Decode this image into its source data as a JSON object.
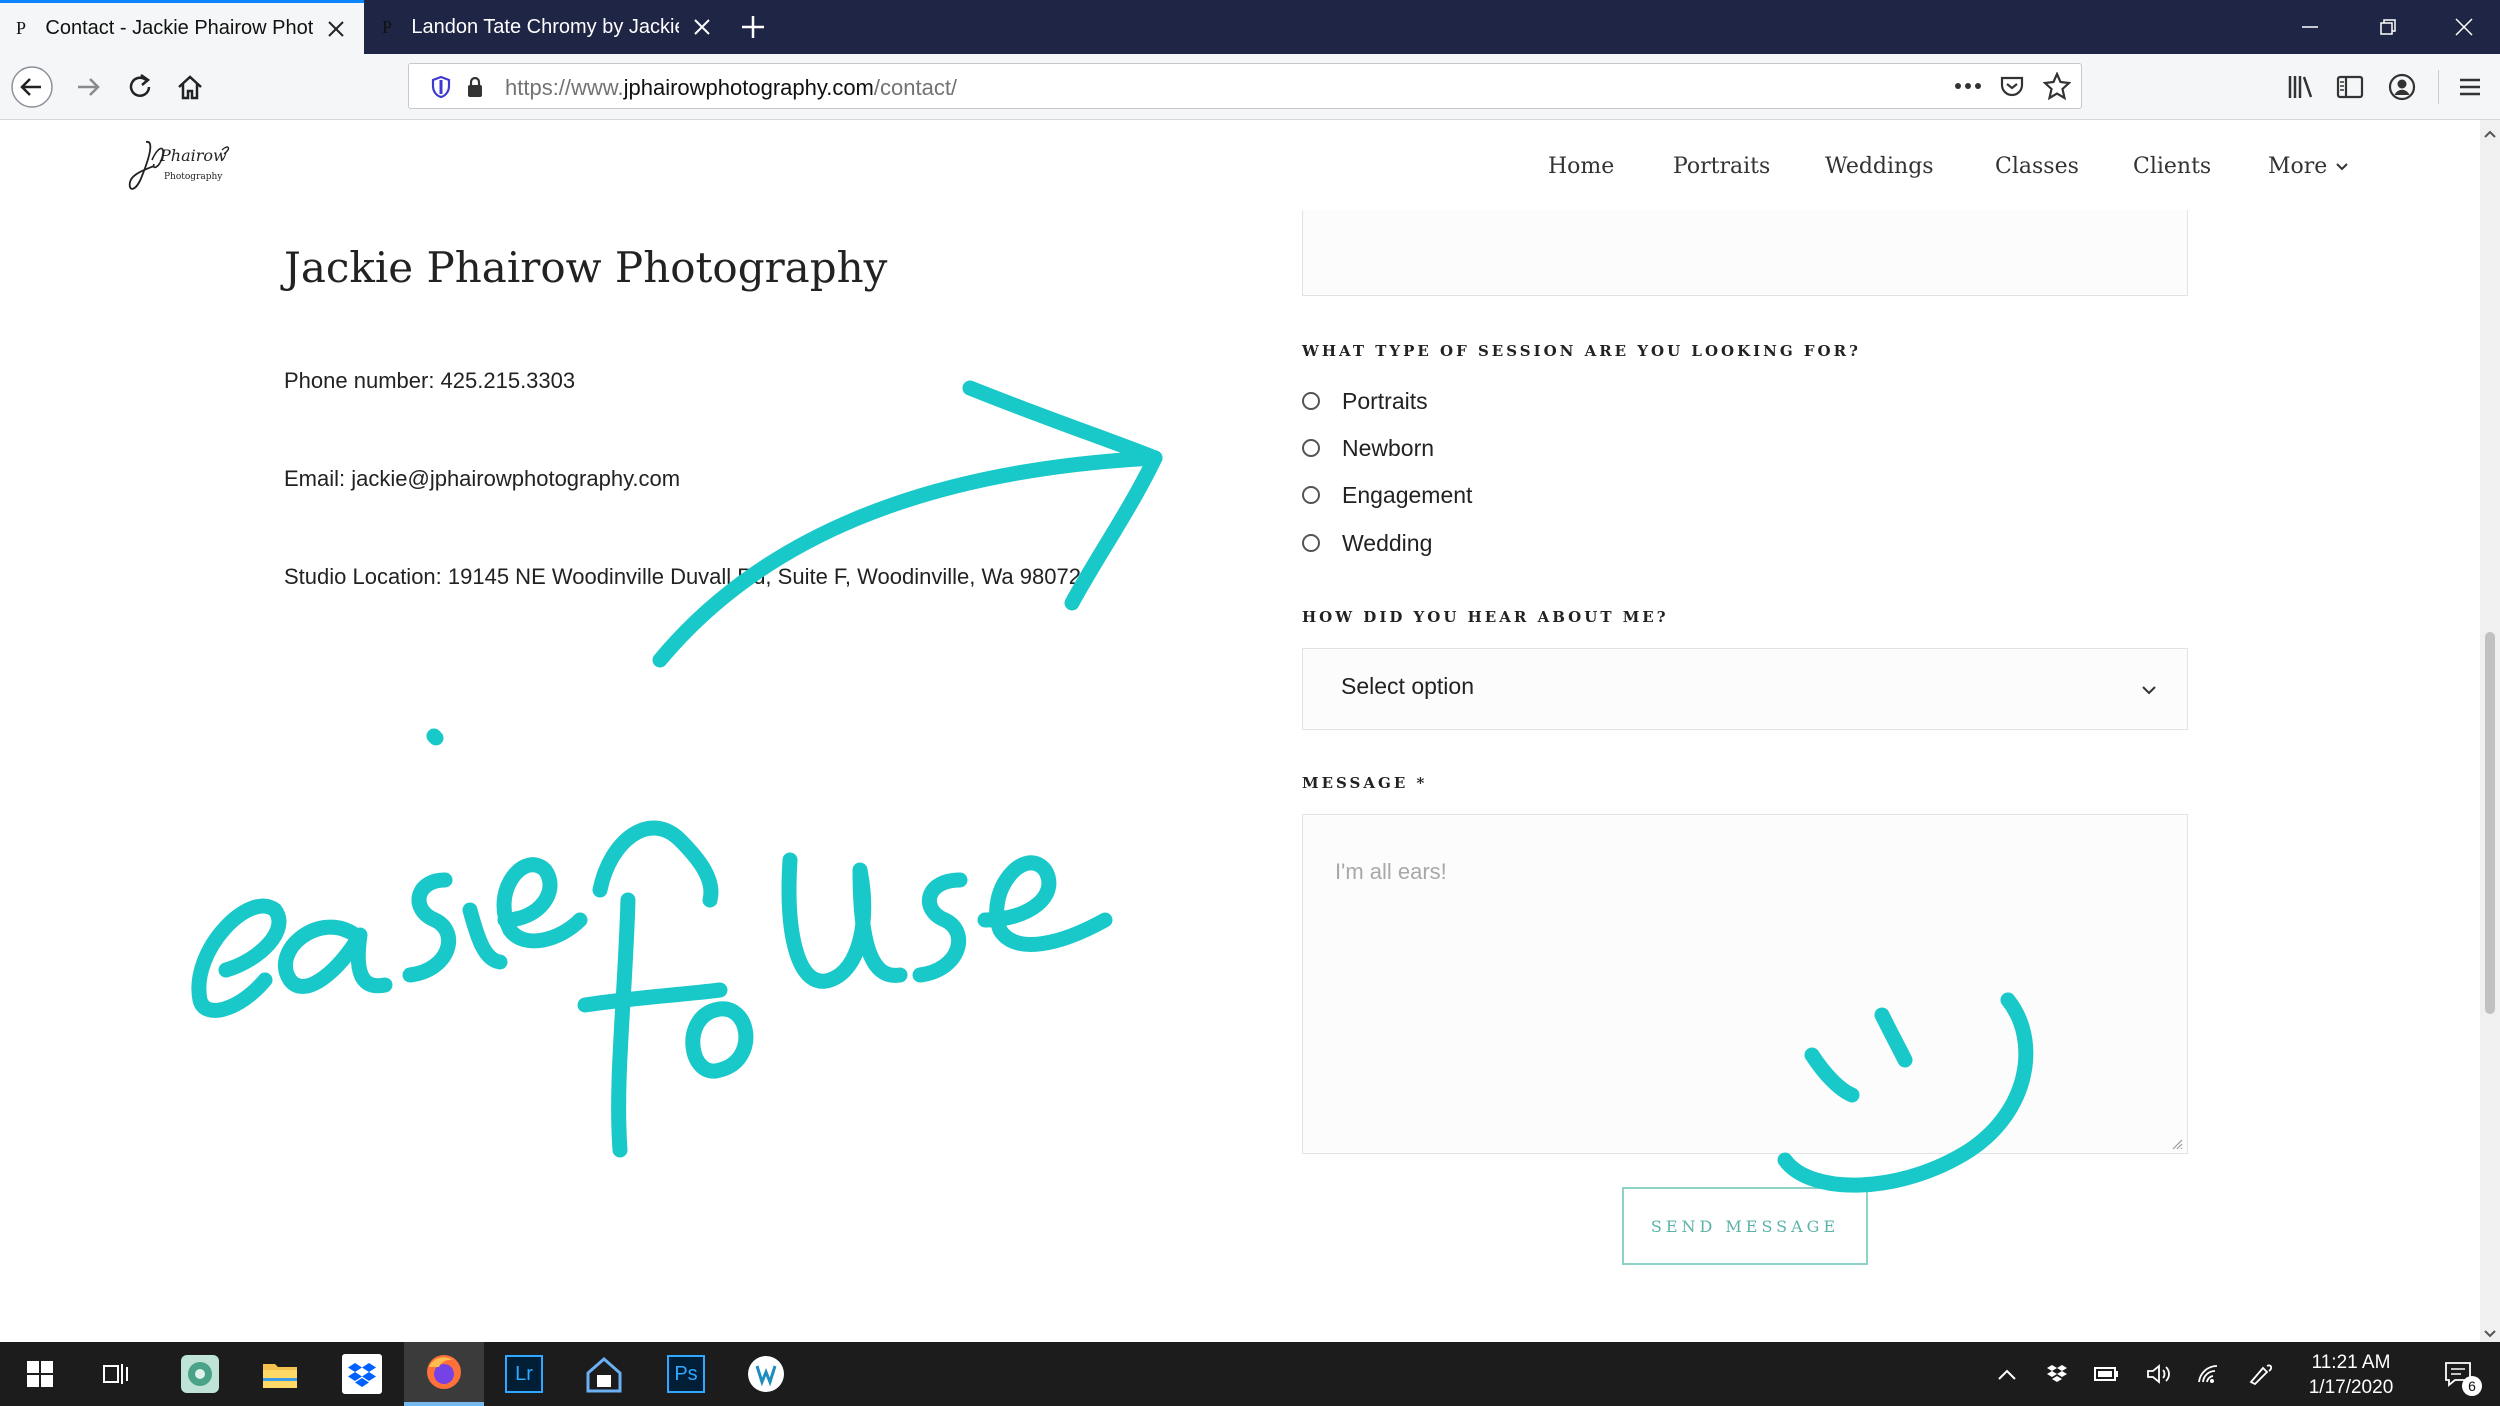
{
  "browser": {
    "tabs": [
      {
        "favicon": "P",
        "title": "Contact - Jackie Phairow Photo",
        "active": true
      },
      {
        "favicon": "P",
        "title": "Landon Tate Chromy by Jackie",
        "active": false
      }
    ],
    "url": {
      "prefix": "https://www.",
      "domain": "jphairowphotography.com",
      "path": "/contact/"
    },
    "icons": [
      "back-icon",
      "forward-icon",
      "reload-icon",
      "home-icon",
      "shield-icon",
      "lock-icon",
      "more-icon",
      "pocket-icon",
      "star-icon",
      "library-icon",
      "sidebar-icon",
      "account-icon",
      "menu-icon"
    ]
  },
  "site": {
    "logo_text": "Phairow",
    "logo_sub": "Photography",
    "nav": [
      "Home",
      "Portraits",
      "Weddings",
      "Classes",
      "Clients",
      "More"
    ]
  },
  "contact": {
    "title": "Jackie Phairow Photography",
    "phone": "Phone number: 425.215.3303",
    "email": "Email: jackie@jphairowphotography.com",
    "location": "Studio Location: 19145 NE Woodinville Duvall Rd, Suite F, Woodinville, Wa 98072"
  },
  "form": {
    "session_label": "WHAT TYPE OF SESSION ARE YOU LOOKING FOR?",
    "session_options": [
      "Portraits",
      "Newborn",
      "Engagement",
      "Wedding"
    ],
    "hear_label": "HOW DID YOU HEAR ABOUT ME?",
    "hear_value": "Select option",
    "message_label": "MESSAGE *",
    "message_placeholder": "I'm all ears!",
    "send_label": "SEND MESSAGE"
  },
  "annotation": {
    "text": "easier to use",
    "color": "#19c8c8"
  },
  "taskbar": {
    "apps": [
      "windows-icon",
      "task-view-icon",
      "photos-icon",
      "file-explorer-icon",
      "dropbox-icon",
      "firefox-icon",
      "lightroom-icon",
      "home-app-icon",
      "photoshop-icon",
      "wordpress-icon"
    ],
    "lightroom": "Lr",
    "photoshop": "Ps",
    "time": "11:21 AM",
    "date": "1/17/2020",
    "notifications": "6"
  }
}
